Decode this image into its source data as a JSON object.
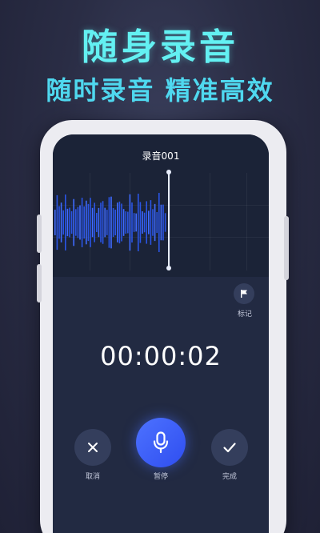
{
  "promo": {
    "headline": "随身录音",
    "subline": "随时录音 精准高效"
  },
  "recorder": {
    "title": "录音001",
    "timer": "00:00:02",
    "mark_label": "标记",
    "cancel_label": "取消",
    "pause_label": "暂停",
    "done_label": "完成"
  },
  "icons": {
    "mark": "flag-icon",
    "cancel": "close-icon",
    "pause": "microphone-icon",
    "done": "check-icon"
  },
  "colors": {
    "headline": "#63f0f2",
    "screen_bg": "#222a42",
    "wave": "#2d5cf0",
    "record_button": "#3a5cf5"
  }
}
